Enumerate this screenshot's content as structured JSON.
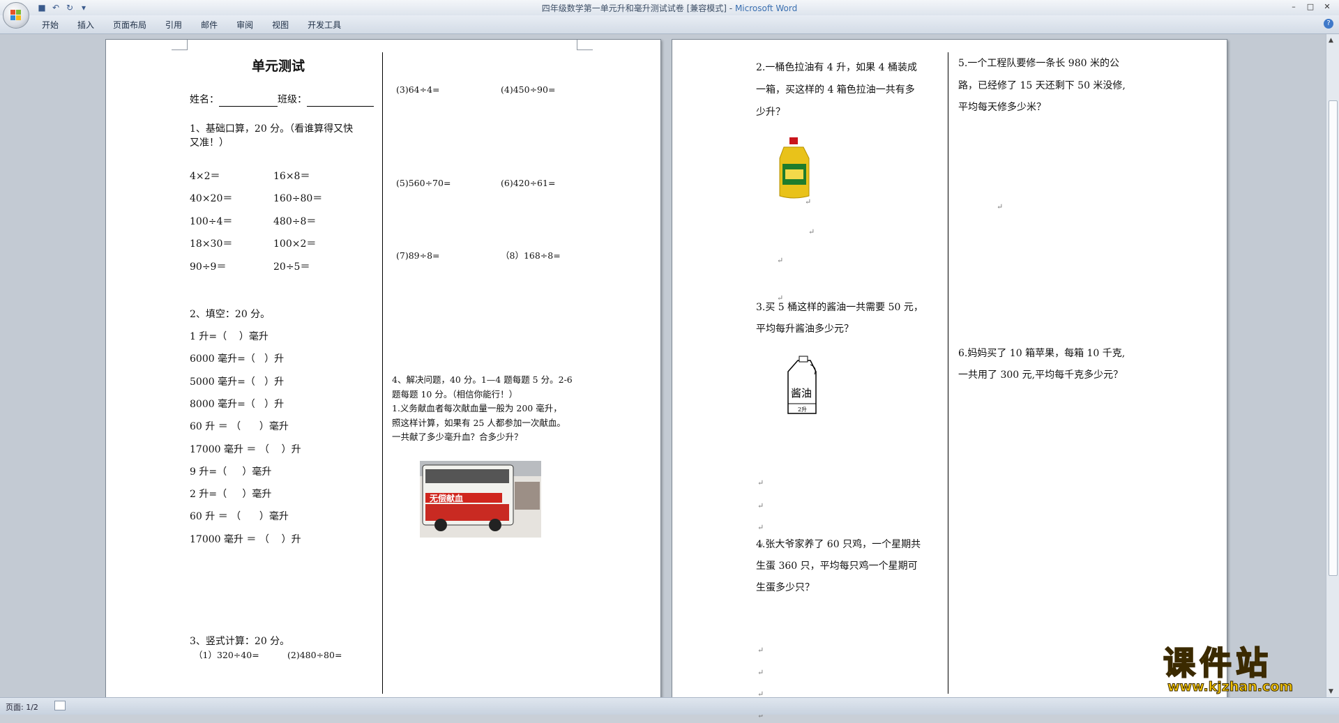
{
  "window": {
    "title": "四年级数学第一单元升和毫升测试试卷 [兼容模式]",
    "title_sep": " - ",
    "app_name": "Microsoft Word"
  },
  "ribbon": {
    "tabs": [
      "开始",
      "插入",
      "页面布局",
      "引用",
      "邮件",
      "审阅",
      "视图",
      "开发工具"
    ]
  },
  "status": {
    "page": "页面: 1/2"
  },
  "page1": {
    "heading": "单元测试",
    "name_label": "姓名：",
    "class_label": "班级：",
    "sec1": "1、基础口算，20 分。（看谁算得又快",
    "sec1b": "又准！）",
    "oral": [
      [
        "4×2＝",
        "16×8＝"
      ],
      [
        "40×20＝",
        "160÷80＝"
      ],
      [
        "100÷4＝",
        "480÷8＝"
      ],
      [
        "18×30＝",
        "100×2＝"
      ],
      [
        "90÷9＝",
        "20÷5＝"
      ]
    ],
    "sec2": "2、填空：20 分。",
    "fill": [
      "1 升=（    ）毫升",
      "6000 毫升=（   ）升",
      "5000 毫升=（   ）升",
      "8000 毫升=（   ）升",
      "60 升 ＝ （      ）毫升",
      "17000 毫升 ＝ （    ）升",
      "9 升=（     ）毫升",
      "2 升=（     ）毫升",
      "60 升 ＝ （      ）毫升",
      "17000 毫升 ＝ （    ）升"
    ],
    "sec3": "3、竖式计算：20 分。",
    "sec3_items": [
      "（1）320÷40=",
      "(2)480÷80="
    ],
    "col2": [
      [
        "(3)64÷4=",
        "(4)450÷90="
      ],
      [
        "(5)560÷70=",
        "(6)420÷61="
      ],
      [
        "(7)89÷8=",
        "（8）168÷8="
      ]
    ],
    "sec4": [
      "4、解决问题，40 分。1—4 题每题 5 分。2-6",
      "题每题 10 分。（相信你能行！）",
      "1.义务献血者每次献血量一般为 200 毫升，",
      "照这样计算，如果有 25 人都参加一次献血。",
      "一共献了多少毫升血？合多少升？"
    ],
    "bus_sign": "无偿献血"
  },
  "page2": {
    "q2": [
      "2.一桶色拉油有 4 升，如果 4 桶装成",
      "一箱，买这样的 4 箱色拉油一共有多",
      "少升？"
    ],
    "q3": [
      "3.买 5 桶这样的酱油一共需要 50 元，",
      "平均每升酱油多少元？"
    ],
    "soy_label": "酱油",
    "soy_volume": "2升",
    "q4": [
      "4.张大爷家养了 60 只鸡，一个星期共",
      "生蛋 360 只，平均每只鸡一个星期可",
      "生蛋多少只？"
    ],
    "q5": [
      "5.一个工程队要修一条长 980 米的公",
      "路，已经修了 15 天还剩下 50 米没修,",
      "平均每天修多少米？"
    ],
    "q6": [
      "6.妈妈买了 10 箱苹果，每箱 10 千克,",
      "一共用了 300 元,平均每千克多少元？"
    ]
  },
  "watermark": {
    "text": "课件站",
    "url": "www.kjzhan.com"
  },
  "paragraph_mark": "↵"
}
